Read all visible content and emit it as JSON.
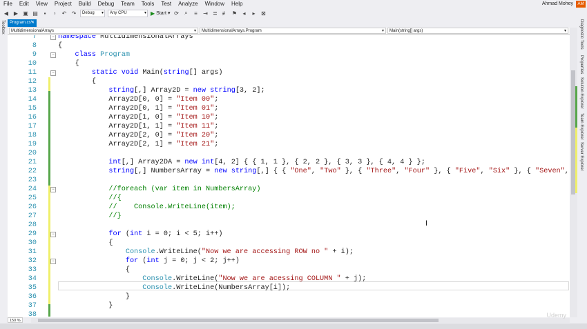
{
  "menu": [
    "File",
    "Edit",
    "View",
    "Project",
    "Build",
    "Debug",
    "Team",
    "Tools",
    "Test",
    "Analyze",
    "Window",
    "Help"
  ],
  "user": {
    "name": "Ahmad Mohey",
    "initials": "AM"
  },
  "toolbar": {
    "config": "Debug",
    "platform": "Any CPU",
    "start_label": "Start"
  },
  "side": {
    "left": "Toolbox",
    "right": [
      "Diagnostic Tools",
      "Properties",
      "Solution Explorer",
      "Team Explorer",
      "Server Explorer"
    ]
  },
  "tab": {
    "label": "Program.cs*",
    "close": "✕"
  },
  "nav": {
    "project": "MultidimensionalArrays",
    "class": "MultidimensionalArrays.Program",
    "member": "Main(string[] args)"
  },
  "zoom": "150 %",
  "watermark": "Udemy",
  "lines": [
    {
      "n": "7",
      "fold": "−",
      "html": "<span class='kw'>namespace</span> MultidimensionalArrays"
    },
    {
      "n": "8",
      "fold": "",
      "html": "{"
    },
    {
      "n": "9",
      "fold": "−",
      "html": "    <span class='kw'>class</span> <span class='ty'>Program</span>"
    },
    {
      "n": "10",
      "fold": "",
      "html": "    {"
    },
    {
      "n": "11",
      "fold": "−",
      "html": "        <span class='kw'>static</span> <span class='kw'>void</span> Main(<span class='kw'>string</span>[] args)"
    },
    {
      "n": "12",
      "fold": "",
      "html": "        {"
    },
    {
      "n": "13",
      "fold": "",
      "html": "            <span class='kw'>string</span>[,] Array2D = <span class='kw'>new</span> <span class='kw'>string</span>[3, 2];"
    },
    {
      "n": "14",
      "fold": "",
      "html": "            Array2D[0, 0] = <span class='st'>\"Item 00\"</span>;"
    },
    {
      "n": "15",
      "fold": "",
      "html": "            Array2D[0, 1] = <span class='st'>\"Item 01\"</span>;"
    },
    {
      "n": "16",
      "fold": "",
      "html": "            Array2D[1, 0] = <span class='st'>\"Item 10\"</span>;"
    },
    {
      "n": "17",
      "fold": "",
      "html": "            Array2D[1, 1] = <span class='st'>\"Item 11\"</span>;"
    },
    {
      "n": "18",
      "fold": "",
      "html": "            Array2D[2, 0] = <span class='st'>\"Item 20\"</span>;"
    },
    {
      "n": "19",
      "fold": "",
      "html": "            Array2D[2, 1] = <span class='st'>\"Item 21\"</span>;"
    },
    {
      "n": "20",
      "fold": "",
      "html": ""
    },
    {
      "n": "21",
      "fold": "",
      "html": "            <span class='kw'>int</span>[,] Array2DA = <span class='kw'>new</span> <span class='kw'>int</span>[4, 2] { { 1, 1 }, { 2, 2 }, { 3, 3 }, { 4, 4 } };"
    },
    {
      "n": "22",
      "fold": "",
      "html": "            <span class='kw'>string</span>[,] NumbersArray = <span class='kw'>new</span> <span class='kw'>string</span>[,] { { <span class='st'>\"One\"</span>, <span class='st'>\"Two\"</span> }, { <span class='st'>\"Three\"</span>, <span class='st'>\"Four\"</span> }, { <span class='st'>\"Five\"</span>, <span class='st'>\"Six\"</span> }, { <span class='st'>\"Seven\"</span>, <span class='st'>\"Eight\"</span> }, { <span class='st'>\"N</span>"
    },
    {
      "n": "23",
      "fold": "",
      "html": ""
    },
    {
      "n": "24",
      "fold": "−",
      "html": "            <span class='cm'>//foreach (var item in NumbersArray)</span>"
    },
    {
      "n": "25",
      "fold": "",
      "html": "            <span class='cm'>//{</span>"
    },
    {
      "n": "26",
      "fold": "",
      "html": "            <span class='cm'>//    Console.WriteLine(item);</span>"
    },
    {
      "n": "27",
      "fold": "",
      "html": "            <span class='cm'>//}</span>"
    },
    {
      "n": "28",
      "fold": "",
      "html": ""
    },
    {
      "n": "29",
      "fold": "−",
      "html": "            <span class='kw'>for</span> (<span class='kw'>int</span> i = 0; i &lt; 5; i++)"
    },
    {
      "n": "30",
      "fold": "",
      "html": "            {"
    },
    {
      "n": "31",
      "fold": "",
      "html": "                <span class='ty'>Console</span>.WriteLine(<span class='st'>\"Now we are accessing ROW no \"</span> + i);"
    },
    {
      "n": "32",
      "fold": "−",
      "html": "                <span class='kw'>for</span> (<span class='kw'>int</span> j = 0; j &lt; 2; j++)"
    },
    {
      "n": "33",
      "fold": "",
      "html": "                {"
    },
    {
      "n": "34",
      "fold": "",
      "html": "                    <span class='ty'>Console</span>.WriteLine(<span class='st'>\"Now we are acessing COLUMN \"</span> + j);"
    },
    {
      "n": "35",
      "fold": "",
      "html": "                    <span class='ty'>Console</span>.WriteLine(NumbersArray[i]);"
    },
    {
      "n": "36",
      "fold": "",
      "html": "                }"
    },
    {
      "n": "37",
      "fold": "",
      "html": "            }"
    },
    {
      "n": "38",
      "fold": "",
      "html": ""
    }
  ]
}
